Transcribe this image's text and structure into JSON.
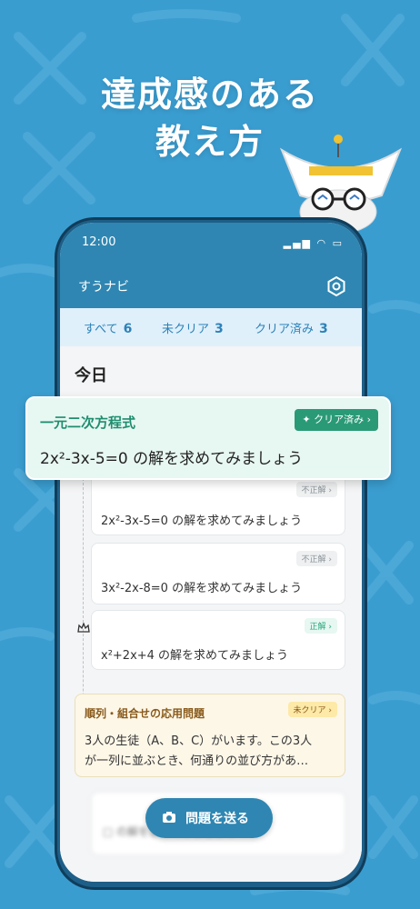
{
  "headline": {
    "line1": "達成感のある",
    "line2": "教え方"
  },
  "status": {
    "time": "12:00",
    "icons": "▂▄▆ ◠ ▭"
  },
  "app": {
    "title": "すうナビ"
  },
  "tabs": [
    {
      "label": "すべて",
      "count": "6"
    },
    {
      "label": "未クリア",
      "count": "3"
    },
    {
      "label": "クリア済み",
      "count": "3"
    }
  ],
  "section": {
    "date": "今日"
  },
  "popout": {
    "title": "一元二次方程式",
    "badge": "クリア済み ›",
    "text": "2x²-3x-5=0 の解を求めてみましょう"
  },
  "problems": [
    {
      "tag": "不正解 ›",
      "text": "2x²-3x-5=0 の解を求めてみましょう"
    },
    {
      "tag": "不正解 ›",
      "text": "3x²-2x-8=0 の解を求めてみましょう"
    },
    {
      "tag": "正解 ›",
      "text": "x²+2x+4 の解を求めてみましょう"
    }
  ],
  "special": {
    "title": "順列・組合せの応用問題",
    "tag": "未クリア ›",
    "line1": "3人の生徒（A、B、C）がいます。この3人",
    "line2": "が一列に並ぶとき、何通りの並び方があ…"
  },
  "blurred": {
    "text": "□ の解を求めてみましょう"
  },
  "send_button": {
    "label": "問題を送る"
  },
  "colors": {
    "background": "#3a9dd0",
    "accent": "#2f86b2",
    "cleared": "#2a9a76",
    "uncleared": "#fde9a8"
  }
}
